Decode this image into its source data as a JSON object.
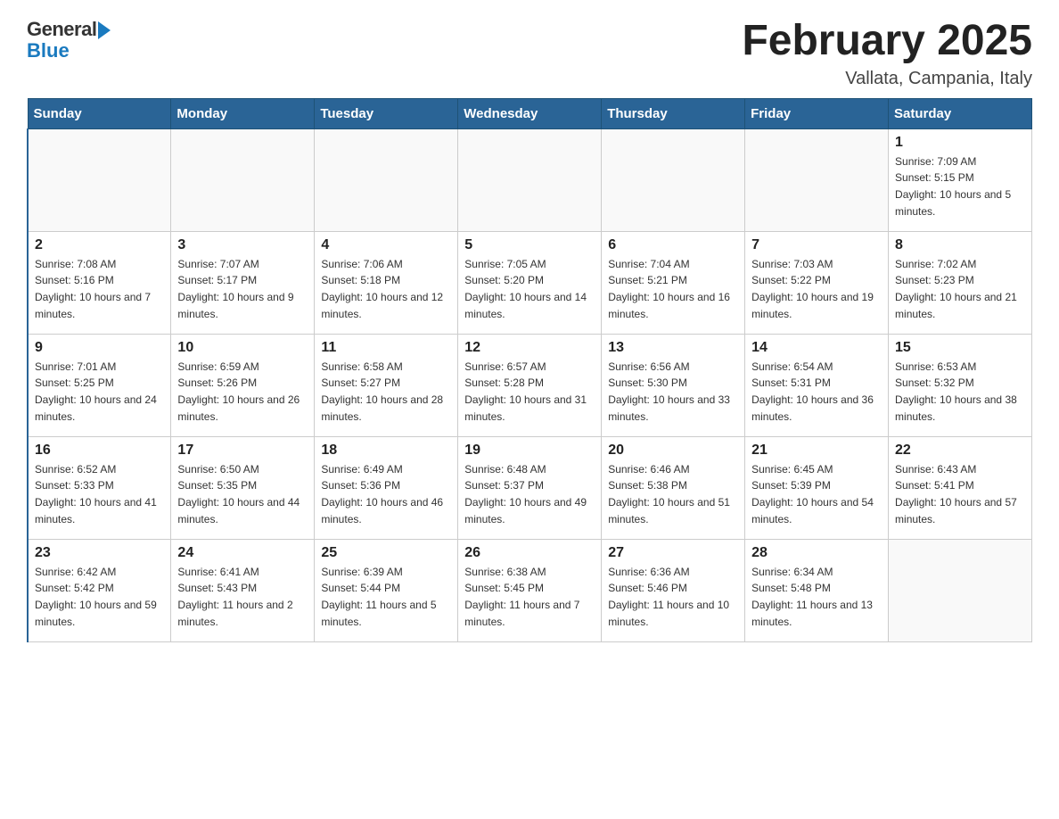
{
  "logo": {
    "general": "General",
    "blue": "Blue"
  },
  "header": {
    "month": "February 2025",
    "location": "Vallata, Campania, Italy"
  },
  "weekdays": [
    "Sunday",
    "Monday",
    "Tuesday",
    "Wednesday",
    "Thursday",
    "Friday",
    "Saturday"
  ],
  "weeks": [
    [
      {
        "day": "",
        "info": ""
      },
      {
        "day": "",
        "info": ""
      },
      {
        "day": "",
        "info": ""
      },
      {
        "day": "",
        "info": ""
      },
      {
        "day": "",
        "info": ""
      },
      {
        "day": "",
        "info": ""
      },
      {
        "day": "1",
        "info": "Sunrise: 7:09 AM\nSunset: 5:15 PM\nDaylight: 10 hours and 5 minutes."
      }
    ],
    [
      {
        "day": "2",
        "info": "Sunrise: 7:08 AM\nSunset: 5:16 PM\nDaylight: 10 hours and 7 minutes."
      },
      {
        "day": "3",
        "info": "Sunrise: 7:07 AM\nSunset: 5:17 PM\nDaylight: 10 hours and 9 minutes."
      },
      {
        "day": "4",
        "info": "Sunrise: 7:06 AM\nSunset: 5:18 PM\nDaylight: 10 hours and 12 minutes."
      },
      {
        "day": "5",
        "info": "Sunrise: 7:05 AM\nSunset: 5:20 PM\nDaylight: 10 hours and 14 minutes."
      },
      {
        "day": "6",
        "info": "Sunrise: 7:04 AM\nSunset: 5:21 PM\nDaylight: 10 hours and 16 minutes."
      },
      {
        "day": "7",
        "info": "Sunrise: 7:03 AM\nSunset: 5:22 PM\nDaylight: 10 hours and 19 minutes."
      },
      {
        "day": "8",
        "info": "Sunrise: 7:02 AM\nSunset: 5:23 PM\nDaylight: 10 hours and 21 minutes."
      }
    ],
    [
      {
        "day": "9",
        "info": "Sunrise: 7:01 AM\nSunset: 5:25 PM\nDaylight: 10 hours and 24 minutes."
      },
      {
        "day": "10",
        "info": "Sunrise: 6:59 AM\nSunset: 5:26 PM\nDaylight: 10 hours and 26 minutes."
      },
      {
        "day": "11",
        "info": "Sunrise: 6:58 AM\nSunset: 5:27 PM\nDaylight: 10 hours and 28 minutes."
      },
      {
        "day": "12",
        "info": "Sunrise: 6:57 AM\nSunset: 5:28 PM\nDaylight: 10 hours and 31 minutes."
      },
      {
        "day": "13",
        "info": "Sunrise: 6:56 AM\nSunset: 5:30 PM\nDaylight: 10 hours and 33 minutes."
      },
      {
        "day": "14",
        "info": "Sunrise: 6:54 AM\nSunset: 5:31 PM\nDaylight: 10 hours and 36 minutes."
      },
      {
        "day": "15",
        "info": "Sunrise: 6:53 AM\nSunset: 5:32 PM\nDaylight: 10 hours and 38 minutes."
      }
    ],
    [
      {
        "day": "16",
        "info": "Sunrise: 6:52 AM\nSunset: 5:33 PM\nDaylight: 10 hours and 41 minutes."
      },
      {
        "day": "17",
        "info": "Sunrise: 6:50 AM\nSunset: 5:35 PM\nDaylight: 10 hours and 44 minutes."
      },
      {
        "day": "18",
        "info": "Sunrise: 6:49 AM\nSunset: 5:36 PM\nDaylight: 10 hours and 46 minutes."
      },
      {
        "day": "19",
        "info": "Sunrise: 6:48 AM\nSunset: 5:37 PM\nDaylight: 10 hours and 49 minutes."
      },
      {
        "day": "20",
        "info": "Sunrise: 6:46 AM\nSunset: 5:38 PM\nDaylight: 10 hours and 51 minutes."
      },
      {
        "day": "21",
        "info": "Sunrise: 6:45 AM\nSunset: 5:39 PM\nDaylight: 10 hours and 54 minutes."
      },
      {
        "day": "22",
        "info": "Sunrise: 6:43 AM\nSunset: 5:41 PM\nDaylight: 10 hours and 57 minutes."
      }
    ],
    [
      {
        "day": "23",
        "info": "Sunrise: 6:42 AM\nSunset: 5:42 PM\nDaylight: 10 hours and 59 minutes."
      },
      {
        "day": "24",
        "info": "Sunrise: 6:41 AM\nSunset: 5:43 PM\nDaylight: 11 hours and 2 minutes."
      },
      {
        "day": "25",
        "info": "Sunrise: 6:39 AM\nSunset: 5:44 PM\nDaylight: 11 hours and 5 minutes."
      },
      {
        "day": "26",
        "info": "Sunrise: 6:38 AM\nSunset: 5:45 PM\nDaylight: 11 hours and 7 minutes."
      },
      {
        "day": "27",
        "info": "Sunrise: 6:36 AM\nSunset: 5:46 PM\nDaylight: 11 hours and 10 minutes."
      },
      {
        "day": "28",
        "info": "Sunrise: 6:34 AM\nSunset: 5:48 PM\nDaylight: 11 hours and 13 minutes."
      },
      {
        "day": "",
        "info": ""
      }
    ]
  ]
}
